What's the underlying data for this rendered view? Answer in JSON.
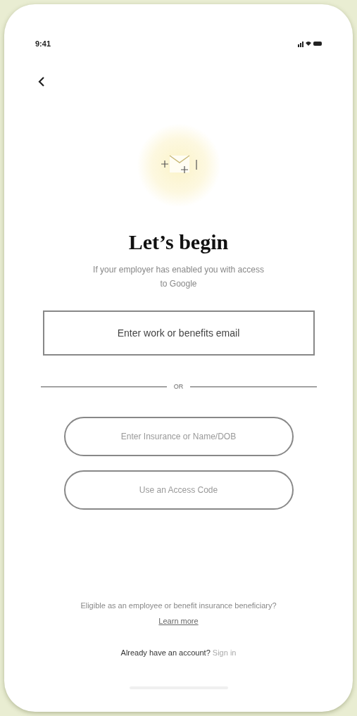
{
  "status_bar": {
    "time": "9:41"
  },
  "title": "Let’s begin",
  "subtitle": "If your employer has enabled you with access to Google",
  "email_field": {
    "placeholder": "Enter work or benefits email"
  },
  "divider": "OR",
  "buttons": [
    "Enter Insurance or Name/DOB",
    "Use an Access Code"
  ],
  "footer": {
    "text": "Eligible as an employee or benefit insurance beneficiary?",
    "link": "Learn more"
  },
  "sign_in": {
    "text": "Already have an account?",
    "link": "Sign in"
  }
}
